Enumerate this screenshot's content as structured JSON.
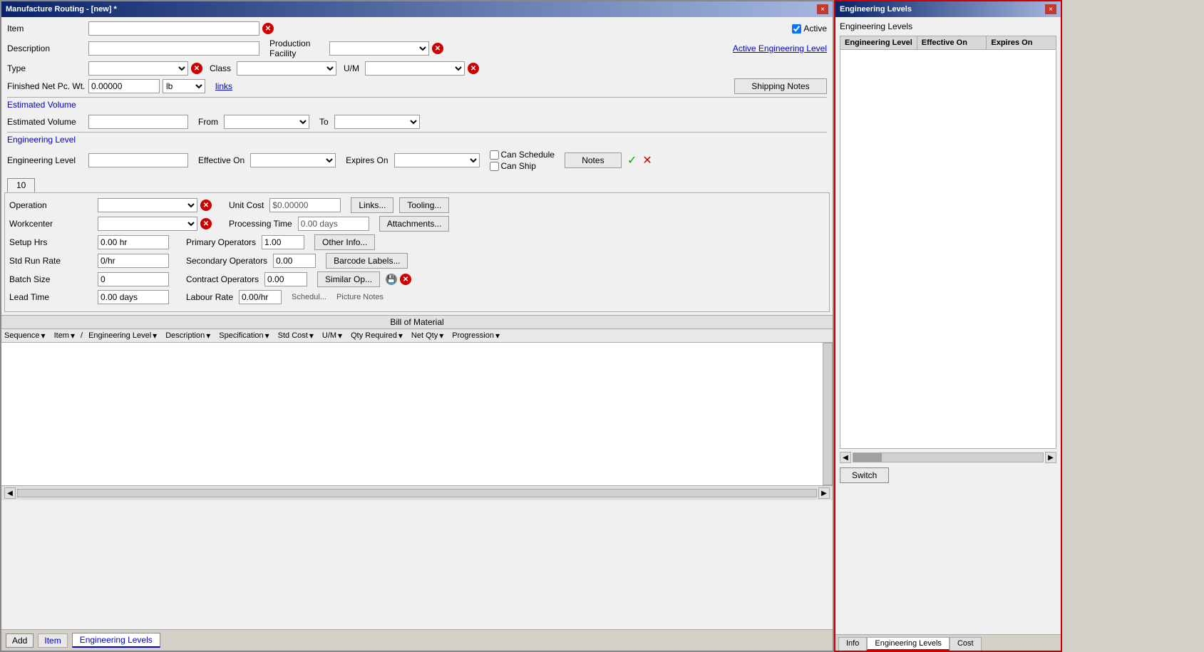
{
  "mainWindow": {
    "title": "Manufacture Routing - [new] *",
    "closeBtn": "×"
  },
  "form": {
    "itemLabel": "Item",
    "descriptionLabel": "Description",
    "typeLabel": "Type",
    "classLabel": "Class",
    "finishedNetLabel": "Finished Net Pc. Wt.",
    "finishedNetValue": "0.00000",
    "finishedNetUnit": "lb",
    "linksLabel": "links",
    "productionFacilityLabel": "Production Facility",
    "umLabel": "U/M",
    "activeLabel": "Active",
    "activeChecked": true,
    "activeEngLabel": "Active Engineering Level",
    "shippingNotesBtn": "Shipping Notes",
    "estimatedVolumeSection": "Estimated Volume",
    "estimatedVolumeLabel": "Estimated Volume",
    "fromLabel": "From",
    "toLabel": "To",
    "engineeringLevelSection": "Engineering Level",
    "engineeringLevelLabel": "Engineering Level",
    "effectiveOnLabel": "Effective On",
    "expiresOnLabel": "Expires On",
    "canScheduleLabel": "Can Schedule",
    "canShipLabel": "Can Ship",
    "notesBtn": "Notes"
  },
  "tab10": {
    "label": "10"
  },
  "operationsPanel": {
    "operationLabel": "Operation",
    "workcenterLabel": "Workcenter",
    "setupHrsLabel": "Setup Hrs",
    "setupHrsValue": "0.00 hr",
    "stdRunRateLabel": "Std Run Rate",
    "stdRunRateValue": "0/hr",
    "batchSizeLabel": "Batch Size",
    "batchSizeValue": "0",
    "leadTimeLabel": "Lead Time",
    "leadTimeValue": "0.00 days",
    "unitCostLabel": "Unit Cost",
    "unitCostValue": "$0.00000",
    "processingTimeLabel": "Processing Time",
    "processingTimeValue": "0.00 days",
    "primaryOperatorsLabel": "Primary Operators",
    "primaryOperatorsValue": "1.00",
    "secondaryOperatorsLabel": "Secondary Operators",
    "secondaryOperatorsValue": "0.00",
    "contractOperatorsLabel": "Contract Operators",
    "contractOperatorsValue": "0.00",
    "labourRateLabel": "Labour Rate",
    "labourRateValue": "0.00/hr",
    "linksBtn": "Links...",
    "toolingBtn": "Tooling...",
    "attachmentsBtn": "Attachments...",
    "otherInfoBtn": "Other Info...",
    "barcodeLabelsBtn": "Barcode Labels...",
    "similarOpBtn": "Similar Op...",
    "pictureNotesLabel": "Picture Notes"
  },
  "billOfMaterial": {
    "title": "Bill of Material",
    "columns": [
      {
        "label": "Sequence",
        "sortable": true
      },
      {
        "label": "Item",
        "sortable": true
      },
      {
        "label": "/",
        "sortable": false
      },
      {
        "label": "Engineering Level",
        "sortable": true
      },
      {
        "label": "Description",
        "sortable": true
      },
      {
        "label": "Specification",
        "sortable": true
      },
      {
        "label": "Std Cost",
        "sortable": true
      },
      {
        "label": "U/M",
        "sortable": true
      },
      {
        "label": "Qty Required",
        "sortable": true
      },
      {
        "label": "Net Qty",
        "sortable": true
      },
      {
        "label": "Progression",
        "sortable": true
      }
    ]
  },
  "bottomBar": {
    "addBtn": "Add",
    "itemBtn": "Item",
    "tabs": [
      "Info",
      "Engineering Levels",
      "Cost"
    ]
  },
  "engineeringPanel": {
    "title": "Engineering Levels",
    "closeBtn": "×",
    "sectionTitle": "Engineering Levels",
    "columns": [
      {
        "label": "Engineering Level"
      },
      {
        "label": "Effective On"
      },
      {
        "label": "Expires On"
      }
    ],
    "switchBtn": "Switch",
    "bottomTabs": [
      "Info",
      "Engineering Levels",
      "Cost"
    ]
  }
}
